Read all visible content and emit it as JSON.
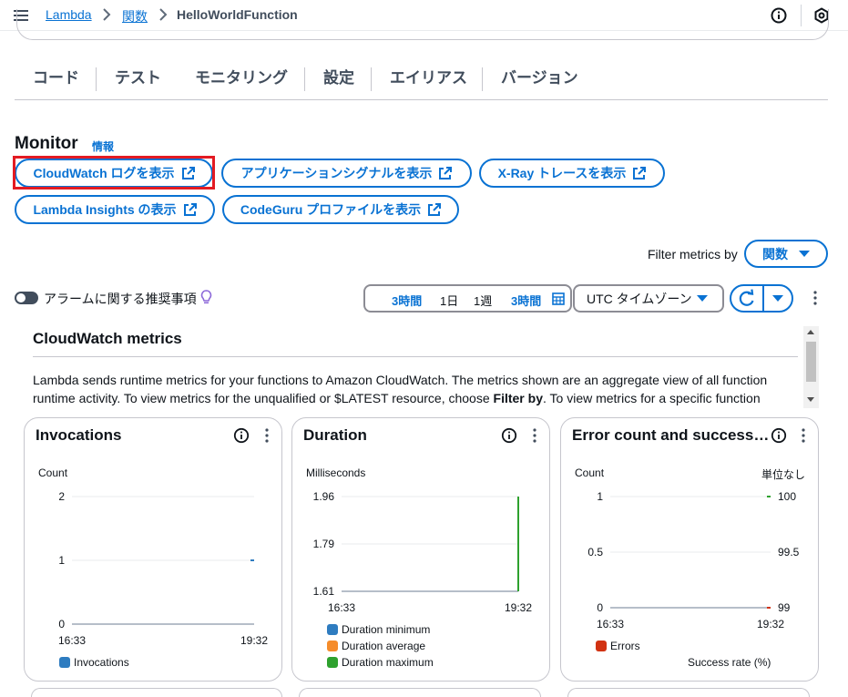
{
  "breadcrumb": {
    "items": [
      "Lambda",
      "関数"
    ],
    "current": "HelloWorldFunction"
  },
  "tabs": [
    {
      "label": "コード",
      "active": false
    },
    {
      "label": "テスト",
      "active": false
    },
    {
      "label": "モニタリング",
      "active": true
    },
    {
      "label": "設定",
      "active": false
    },
    {
      "label": "エイリアス",
      "active": false
    },
    {
      "label": "バージョン",
      "active": false
    }
  ],
  "monitor": {
    "title": "Monitor",
    "info_label": "情報",
    "buttons": [
      "CloudWatch ログを表示",
      "アプリケーションシグナルを表示",
      "X-Ray トレースを表示",
      "Lambda Insights の表示",
      "CodeGuru プロファイルを表示"
    ]
  },
  "filter": {
    "label": "Filter metrics by",
    "value": "関数"
  },
  "alarm": {
    "label": "アラームに関する推奨事項",
    "enabled": false
  },
  "time_range": {
    "options": [
      "3時間",
      "1日",
      "1週",
      "3時間"
    ],
    "selected_index": 0
  },
  "timezone": {
    "value": "UTC タイムゾーン"
  },
  "cloudwatch": {
    "title": "CloudWatch metrics",
    "desc_part1": "Lambda sends runtime metrics for your functions to Amazon CloudWatch. The metrics shown are an aggregate view of all function runtime activity. To view metrics for the unqualified or $LATEST resource, choose ",
    "desc_bold": "Filter by",
    "desc_part2": ". To view metrics for a specific function"
  },
  "colors": {
    "accent": "#0972d3",
    "highlight": "#e31b23",
    "duration_min": "#2e7cc0",
    "duration_avg": "#f58c2b",
    "duration_max": "#2ea12e",
    "errors": "#d13212"
  },
  "chart_data": [
    {
      "type": "line",
      "title": "Invocations",
      "ylabel": "Count",
      "x_ticks": [
        "16:33",
        "19:32"
      ],
      "y_ticks": [
        "2",
        "1",
        "0"
      ],
      "ylim": [
        0,
        2
      ],
      "series": [
        {
          "name": "Invocations",
          "color": "#2e7cc0",
          "points": [
            {
              "x": "19:32",
              "y": 1
            }
          ]
        }
      ]
    },
    {
      "type": "line",
      "title": "Duration",
      "ylabel": "Milliseconds",
      "x_ticks": [
        "16:33",
        "19:32"
      ],
      "y_ticks": [
        "1.96",
        "1.79",
        "1.61"
      ],
      "ylim": [
        1.61,
        1.96
      ],
      "series": [
        {
          "name": "Duration minimum",
          "color": "#2e7cc0",
          "points": [
            {
              "x": "19:32",
              "y": 1.61
            },
            {
              "x": "19:32",
              "y": 1.96
            }
          ]
        },
        {
          "name": "Duration average",
          "color": "#f58c2b",
          "points": [
            {
              "x": "19:32",
              "y": 1.61
            },
            {
              "x": "19:32",
              "y": 1.96
            }
          ]
        },
        {
          "name": "Duration maximum",
          "color": "#2ea12e",
          "points": [
            {
              "x": "19:32",
              "y": 1.61
            },
            {
              "x": "19:32",
              "y": 1.96
            }
          ]
        }
      ]
    },
    {
      "type": "line",
      "title": "Error count and success ...",
      "ylabel": "Count",
      "ylabel_right": "単位なし",
      "x_ticks": [
        "16:33",
        "19:32"
      ],
      "y_ticks": [
        "1",
        "0.5",
        "0"
      ],
      "y2_ticks": [
        "100",
        "99.5",
        "99"
      ],
      "ylim": [
        0,
        1
      ],
      "y2lim": [
        99,
        100
      ],
      "series": [
        {
          "name": "Errors",
          "color": "#d13212",
          "points": [
            {
              "x": "19:32",
              "y": 0
            }
          ]
        },
        {
          "name": "Success rate (%)",
          "color": "#2ea12e",
          "axis": "right",
          "points": [
            {
              "x": "19:32",
              "y": 100
            }
          ]
        }
      ]
    }
  ]
}
